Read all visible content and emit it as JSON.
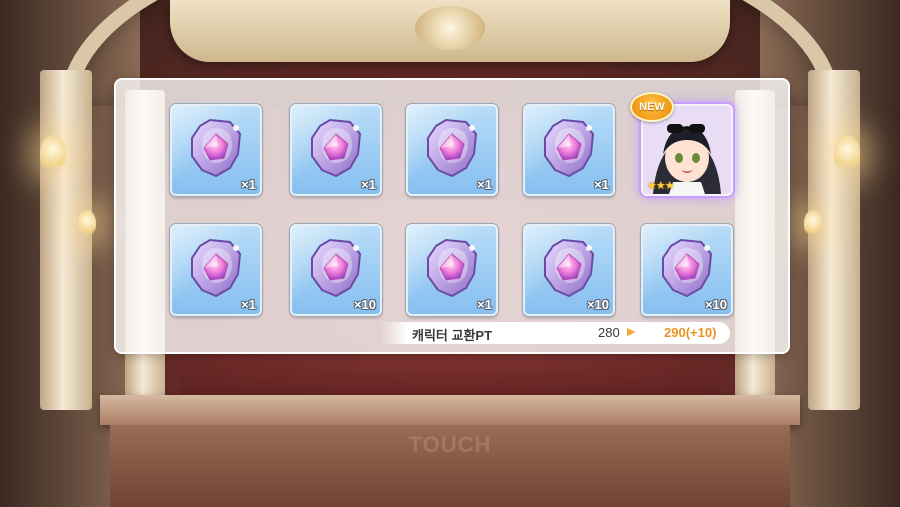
{
  "results": {
    "items": [
      {
        "type": "memory-piece",
        "qty": "×1"
      },
      {
        "type": "memory-piece",
        "qty": "×1"
      },
      {
        "type": "memory-piece",
        "qty": "×1"
      },
      {
        "type": "memory-piece",
        "qty": "×1"
      },
      {
        "type": "character",
        "badge": "NEW",
        "stars": "★★★"
      },
      {
        "type": "memory-piece",
        "qty": "×1"
      },
      {
        "type": "memory-piece",
        "qty": "×10"
      },
      {
        "type": "memory-piece",
        "qty": "×1"
      },
      {
        "type": "memory-piece",
        "qty": "×10"
      },
      {
        "type": "memory-piece",
        "qty": "×10"
      }
    ]
  },
  "points": {
    "label": "캐릭터 교환PT",
    "old_value": "280",
    "arrow": "▶",
    "new_value": "290(+10)"
  },
  "prompt": {
    "touch_text": "TOUCH"
  },
  "colors": {
    "tile_blue": "#9fd0f5",
    "gem_purple": "#b48be8",
    "gem_pink": "#f07cd8",
    "new_badge": "#f5a51c",
    "points_accent": "#e8921f"
  }
}
